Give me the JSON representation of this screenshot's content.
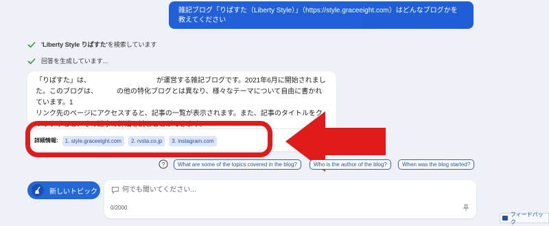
{
  "user_message": "雑記ブログ「りぱすた（Liberty Style）」（https://style.graceeight.com）はどんなブログかを教えてください",
  "status": {
    "searching_query": "'Liberty Style りぱすた'",
    "searching_suffix": " を検索しています",
    "generating": "回答を生成しています..."
  },
  "answer": {
    "p1_a": "「りぱすた」は、",
    "p1_b": "が運営する雑記ブログです。2021年6月に開始されました。このブログは、",
    "p1_c": "の他の特化ブログとは異なり、様々なテーマについて自由に書かれています。1",
    "p2": "リンク先のページにアクセスすると、記事の一覧が表示されます。また、記事のタイトルをクリックすると、その記事の詳細を読むことができます。"
  },
  "details": {
    "label": "詳細情報:",
    "links": [
      "1. style.graceeight.com",
      "2. rvsta.co.jp",
      "3. instagram.com"
    ]
  },
  "suggestions": [
    "What are some of the topics covered in the blog?",
    "Who is the author of the blog?",
    "When was the blog started?"
  ],
  "new_topic": {
    "label": "新しいトピック"
  },
  "composer": {
    "placeholder": "何でも聞いてください...",
    "counter": "0/2000"
  },
  "feedback": {
    "label": "フィードバック"
  },
  "colors": {
    "accent_blue": "#2160d8",
    "highlight_red": "#e11a1a",
    "check_green": "#2a9d3a"
  },
  "icons": [
    "check-icon",
    "help-icon",
    "broom-icon",
    "chat-icon",
    "pin-icon",
    "feedback-icon",
    "arrow-icon"
  ]
}
